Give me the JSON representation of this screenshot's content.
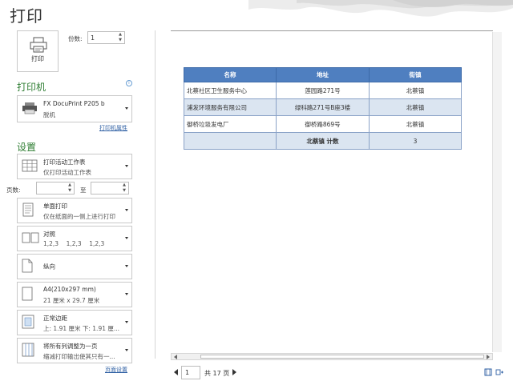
{
  "page": {
    "title": "打印"
  },
  "print_button": {
    "label": "打印"
  },
  "copies": {
    "label": "份数:",
    "value": "1"
  },
  "printer": {
    "heading": "打印机",
    "name": "FX DocuPrint P205 b",
    "status": "脱机",
    "properties_link": "打印机属性"
  },
  "settings": {
    "heading": "设置",
    "scope": {
      "line1": "打印活动工作表",
      "line2": "仅打印活动工作表"
    },
    "pages": {
      "label": "页数:",
      "from": "",
      "to": "",
      "to_label": "至"
    },
    "sides": {
      "line1": "单面打印",
      "line2": "仅在纸面的一侧上进行打印"
    },
    "collate": {
      "line1": "对照",
      "line2": "1,2,3    1,2,3    1,2,3"
    },
    "orientation": {
      "line1": "纵向"
    },
    "paper": {
      "line1": "A4(210x297 mm)",
      "line2": "21 厘米 x 29.7 厘米"
    },
    "margins": {
      "line1": "正常边距",
      "line2": "上: 1.91 厘米 下: 1.91 厘..."
    },
    "scaling": {
      "line1": "将所有列调整为一页",
      "line2": "缩减打印输出使其只有一..."
    },
    "page_setup_link": "页面设置"
  },
  "preview_table": {
    "headers": [
      "名称",
      "地址",
      "街镇"
    ],
    "rows": [
      [
        "北蔡社区卫生服务中心",
        "莲园路271号",
        "北蔡镇"
      ],
      [
        "浦发环境服务有限公司",
        "绿科路271号B座3楼",
        "北蔡镇"
      ],
      [
        "御桥垃圾发电厂",
        "御桥路869号",
        "北蔡镇"
      ]
    ],
    "total_label": "北蔡镇 计数",
    "total_value": "3"
  },
  "pager": {
    "current": "1",
    "total": "共 17 页"
  },
  "colors": {
    "accent_green": "#2e7d32",
    "table_header": "#4f7fc0",
    "table_band": "#dbe5f1"
  },
  "icons": [
    "printer-icon",
    "info-icon",
    "sheet-icon",
    "pages-icon",
    "collate-icon",
    "portrait-icon",
    "paper-icon",
    "margins-icon",
    "scaling-icon",
    "show-margins-icon",
    "zoom-page-icon"
  ]
}
